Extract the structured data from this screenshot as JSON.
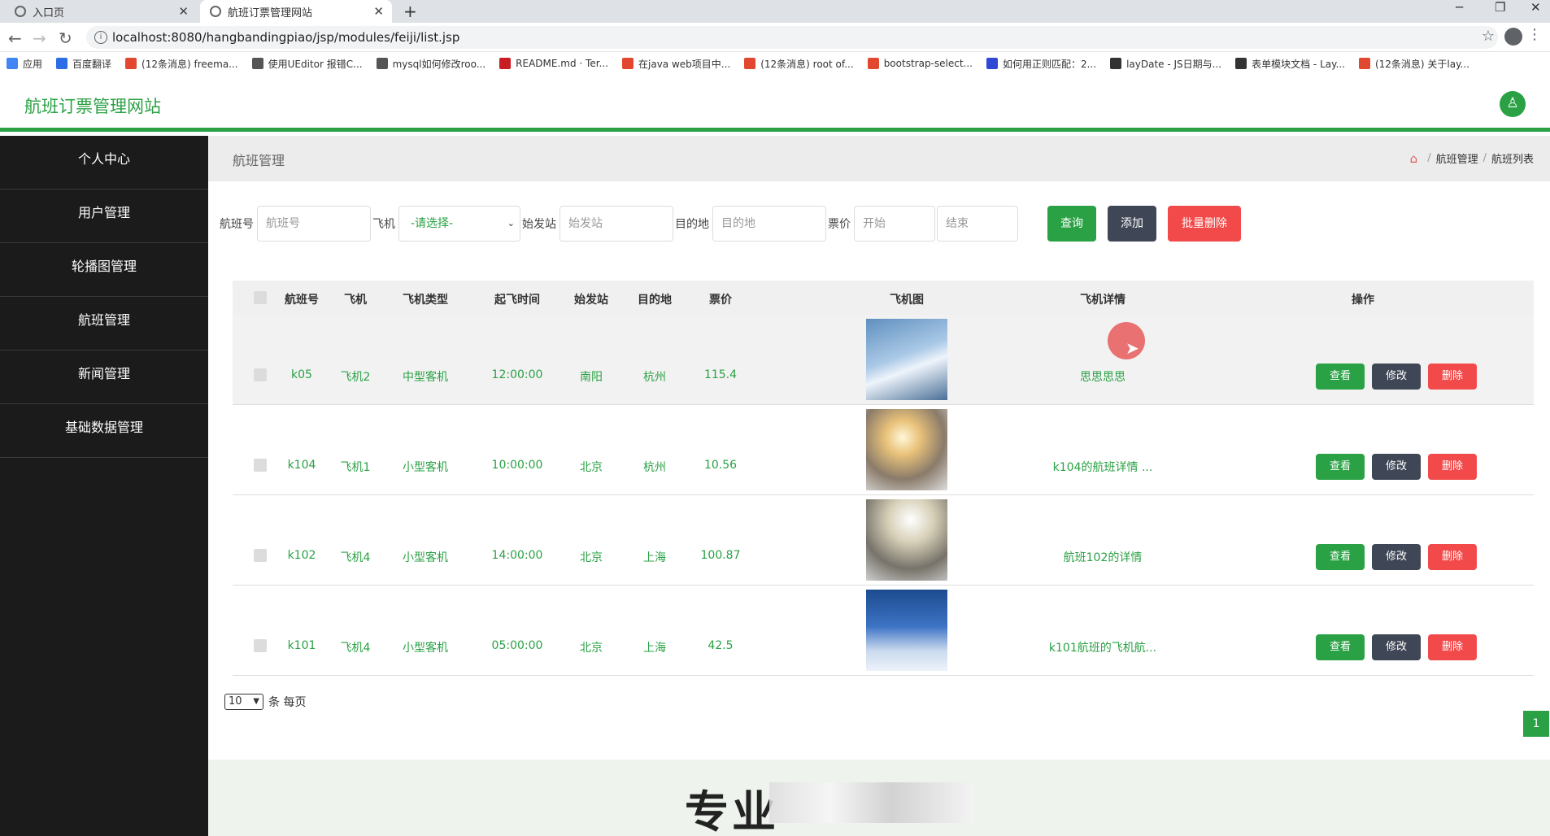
{
  "browser": {
    "tabs": [
      {
        "title": "入口页",
        "active": false
      },
      {
        "title": "航班订票管理网站",
        "active": true
      }
    ],
    "url": "localhost:8080/hangbandingpiao/jsp/modules/feiji/list.jsp",
    "bookmarks": [
      {
        "label": "应用",
        "color": "#4285f4"
      },
      {
        "label": "百度翻译",
        "color": "#2b6de5"
      },
      {
        "label": "(12条消息) freema...",
        "color": "#e2482f"
      },
      {
        "label": "使用UEditor 报错C...",
        "color": "#555555"
      },
      {
        "label": "mysql如何修改roo...",
        "color": "#555555"
      },
      {
        "label": "README.md · Ter...",
        "color": "#c71d23"
      },
      {
        "label": "在java web项目中...",
        "color": "#e2482f"
      },
      {
        "label": "(12条消息) root of...",
        "color": "#e2482f"
      },
      {
        "label": "bootstrap-select...",
        "color": "#e2482f"
      },
      {
        "label": "如何用正则匹配：2...",
        "color": "#3048d6"
      },
      {
        "label": "layDate - JS日期与...",
        "color": "#333333"
      },
      {
        "label": "表单模块文档 - Lay...",
        "color": "#333333"
      },
      {
        "label": "(12条消息) 关于lay...",
        "color": "#e2482f"
      }
    ]
  },
  "app": {
    "title": "航班订票管理网站",
    "accent": "#2aa144"
  },
  "sidebar": {
    "items": [
      {
        "label": "个人中心"
      },
      {
        "label": "用户管理"
      },
      {
        "label": "轮播图管理"
      },
      {
        "label": "航班管理"
      },
      {
        "label": "新闻管理"
      },
      {
        "label": "基础数据管理"
      }
    ]
  },
  "page": {
    "title": "航班管理",
    "breadcrumb": [
      "航班管理",
      "航班列表"
    ]
  },
  "filters": {
    "flight_no_label": "航班号",
    "flight_no_placeholder": "航班号",
    "plane_label": "飞机",
    "plane_selected": "-请选择-",
    "origin_label": "始发站",
    "origin_placeholder": "始发站",
    "dest_label": "目的地",
    "dest_placeholder": "目的地",
    "price_label": "票价",
    "price_start_placeholder": "开始",
    "price_end_placeholder": "结束",
    "query_btn": "查询",
    "add_btn": "添加",
    "batch_delete_btn": "批量删除"
  },
  "table": {
    "headers": [
      "航班号",
      "飞机",
      "飞机类型",
      "起飞时间",
      "始发站",
      "目的地",
      "票价",
      "飞机图",
      "飞机详情",
      "操作"
    ],
    "rows": [
      {
        "flight_no": "k05",
        "plane": "飞机2",
        "plane_type": "中型客机",
        "departure": "12:00:00",
        "origin": "南阳",
        "dest": "杭州",
        "price": "115.4",
        "detail": "思思思思"
      },
      {
        "flight_no": "k104",
        "plane": "飞机1",
        "plane_type": "小型客机",
        "departure": "10:00:00",
        "origin": "北京",
        "dest": "杭州",
        "price": "10.56",
        "detail": "k104的航班详情 ..."
      },
      {
        "flight_no": "k102",
        "plane": "飞机4",
        "plane_type": "小型客机",
        "departure": "14:00:00",
        "origin": "北京",
        "dest": "上海",
        "price": "100.87",
        "detail": "航班102的详情"
      },
      {
        "flight_no": "k101",
        "plane": "飞机4",
        "plane_type": "小型客机",
        "departure": "05:00:00",
        "origin": "北京",
        "dest": "上海",
        "price": "42.5",
        "detail": "k101航班的飞机航..."
      }
    ],
    "actions": {
      "view": "查看",
      "edit": "修改",
      "delete": "删除"
    }
  },
  "pagination": {
    "page_size": "10",
    "per_page_label": "条 每页",
    "current_page": "1"
  },
  "footer": {
    "slogan_fragment": "专业"
  }
}
